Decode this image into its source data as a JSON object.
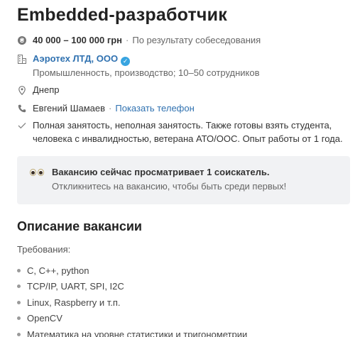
{
  "vacancy": {
    "title": "Embedded-разработчик",
    "salary": "40 000 – 100 000 грн",
    "salary_note": "По результату собеседования",
    "company_name": "Аэротех ЛТД, ООО",
    "company_info": "Промышленность, производство; 10–50 сотрудников",
    "location": "Днепр",
    "contact_name": "Евгений Шамаев",
    "show_phone_label": "Показать телефон",
    "conditions_line1": "Полная занятость, неполная занятость. Также готовы взять студента,",
    "conditions_line2": "человека с инвалидностью, ветерана АТО/ООС. Опыт работы от 1 года."
  },
  "notice": {
    "title": "Вакансию сейчас просматривает 1 соискатель.",
    "subtitle": "Откликнитесь на вакансию, чтобы быть среди первых!"
  },
  "description": {
    "heading": "Описание вакансии",
    "requirements_label": "Требования:",
    "requirements": [
      "C, C++, python",
      "TCP/IP, UART, SPI, I2C",
      "Linux, Raspberry и т.п.",
      "OpenCV",
      "Математика на уровне статистики и тригонометрии"
    ]
  },
  "icons": {
    "salary": "hryvnia-coin-icon",
    "company": "building-icon",
    "verified": "verified-check-icon",
    "location": "map-pin-icon",
    "phone": "phone-icon",
    "conditions": "checkmark-icon",
    "viewers": "eyes-icon"
  },
  "colors": {
    "link": "#2f71b0",
    "verified": "#38a4e0",
    "notice_bg": "#f1f2f4"
  }
}
